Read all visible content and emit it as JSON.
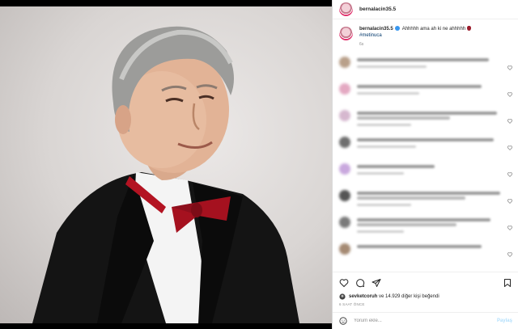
{
  "post": {
    "username": "bernalacin35.5",
    "caption_text": "Ahhhhh ama ah ki ne ahhhhh",
    "hashtag": "#metinuca",
    "caption_time": "6s"
  },
  "actions": {
    "liked_by_user": "sevketcoruh",
    "liked_by_rest": "ve 14.929 diğer kişi beğendi",
    "time_ago": "6 SAAT ÖNCE"
  },
  "composer": {
    "placeholder": "Yorum ekle...",
    "post_label": "Paylaş"
  },
  "colors": {
    "link_blue": "#00376b",
    "verified_blue": "#3897f0",
    "post_button_disabled": "#b2dffc"
  }
}
